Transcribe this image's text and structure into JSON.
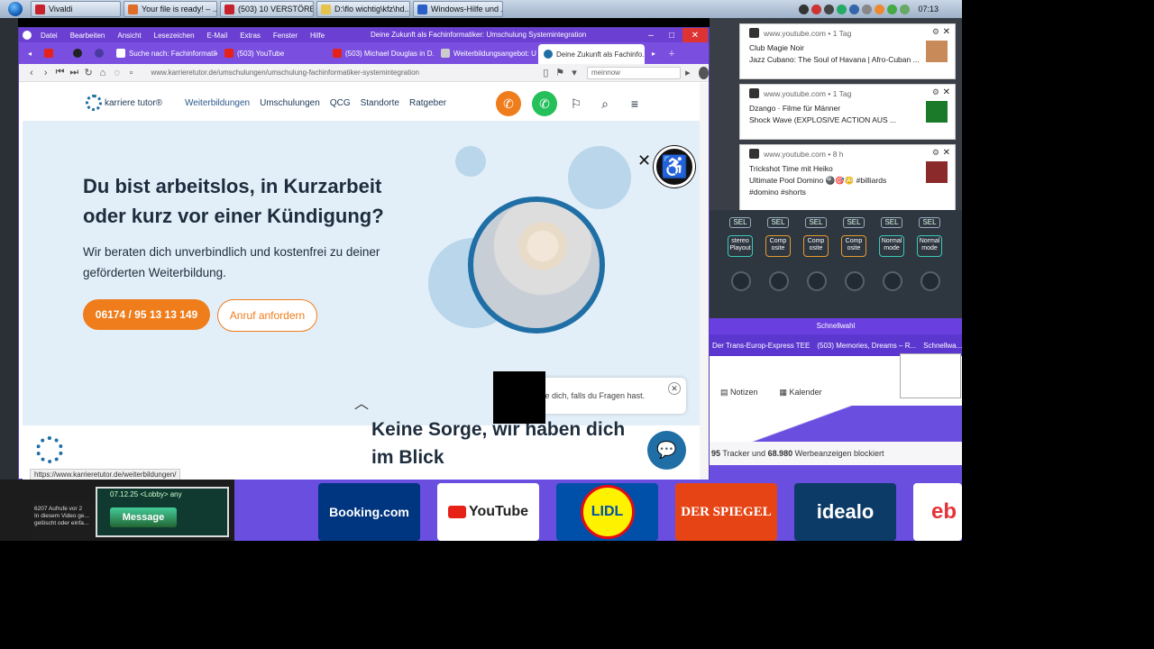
{
  "taskbar": {
    "apps": [
      {
        "label": "Vivaldi",
        "color": "#c8232c"
      },
      {
        "label": "Your file is ready! – ...",
        "color": "#e06c2a"
      },
      {
        "label": "(503) 10 VERSTÖREN...",
        "color": "#c8232c"
      },
      {
        "label": "D:\\flo wichtig\\kfz\\hd...",
        "color": "#e6c44a"
      },
      {
        "label": "Windows-Hilfe und ...",
        "color": "#2a5fc8"
      }
    ],
    "clock": "07:13"
  },
  "browser": {
    "menu": [
      "Datei",
      "Bearbeiten",
      "Ansicht",
      "Lesezeichen",
      "E-Mail",
      "Extras",
      "Fenster",
      "Hilfe"
    ],
    "window_title": "Deine Zukunft als Fachinformatiker: Umschulung Systemintegration",
    "tabs": [
      {
        "label": "",
        "color": "#e62117"
      },
      {
        "label": "Suche nach: Fachinformatik",
        "color": "#fff"
      },
      {
        "label": "(503) YouTube",
        "color": "#e62117"
      },
      {
        "label": "(503) Michael Douglas in D...",
        "color": "#e62117"
      },
      {
        "label": "Weiterbildungsangebot: Ur...",
        "color": "#ccc"
      },
      {
        "label": "Deine Zukunft als Fachinfo...",
        "color": "#1f6fa6"
      }
    ],
    "url": "www.karrieretutor.de/umschulungen/umschulung-fachinformatiker-systemintegration",
    "search_value": "meinnow",
    "status_url": "https://www.karrieretutor.de/weiterbildungen/"
  },
  "site": {
    "logo_text": "karriere tutor®",
    "nav": [
      "Weiterbildungen",
      "Umschulungen",
      "QCG",
      "Standorte",
      "Ratgeber"
    ],
    "headline": "Du bist arbeitslos, in Kurzarbeit oder kurz vor einer Kündigung?",
    "subline": "Wir beraten dich unverbindlich und kostenfrei zu deiner geförderten Weiterbildung.",
    "phone_button": "06174 / 95 13 13 149",
    "call_button": "Anruf anfordern",
    "section2_heading": "Keine Sorge, wir haben dich im Blick",
    "chat_popup": "...e dich, falls du Fragen hast.",
    "colors": {
      "accent": "#ef7d1c",
      "primary": "#1f6fa6",
      "hero_bg": "#e3eff8"
    }
  },
  "notifications": [
    {
      "source": "www.youtube.com",
      "age": "1 Tag",
      "title": "Club Magie Noir",
      "body": "Jazz Cubano: The Soul of Havana | Afro-Cuban ...",
      "extra": ""
    },
    {
      "source": "www.youtube.com",
      "age": "1 Tag",
      "title": "Dzango · Filme für Männer",
      "body": "Shock Wave (EXPLOSIVE ACTION AUS ...",
      "extra": ""
    },
    {
      "source": "www.youtube.com",
      "age": "8 h",
      "title": "Trickshot Time mit Heiko",
      "body": "Ultimate Pool Domino 🎱🎯😳 #billiards",
      "extra": "#domino #shorts"
    }
  ],
  "mixer": {
    "sel_label": "SEL",
    "modes": [
      "stereo Playout",
      "Comp osite",
      "Comp osite",
      "Comp osite",
      "Normal mode",
      "Normal mode"
    ]
  },
  "speeddial": {
    "title": "Schnellwahl",
    "vtabs": [
      "Der Trans-Europ-Express TEE",
      "(503) Memories, Dreams – R...",
      "Schnellwa..."
    ],
    "notes": "Notizen",
    "calendar": "Kalender",
    "tracker_count": "95",
    "tracker_mid": "Tracker und",
    "ads_count": "68.980",
    "ads_text": "Werbeanzeigen blockiert",
    "tiles": [
      "Booking.com",
      "YouTube",
      "LIDL",
      "DER SPIEGEL",
      "idealo",
      "eb"
    ]
  },
  "left": {
    "views": "6207 Aufrufe vor 2",
    "text": "In diesem Video ge... gelöscht oder einfa...",
    "message_button": "Message",
    "lobby": "07.12.25 <Lobby> any"
  }
}
